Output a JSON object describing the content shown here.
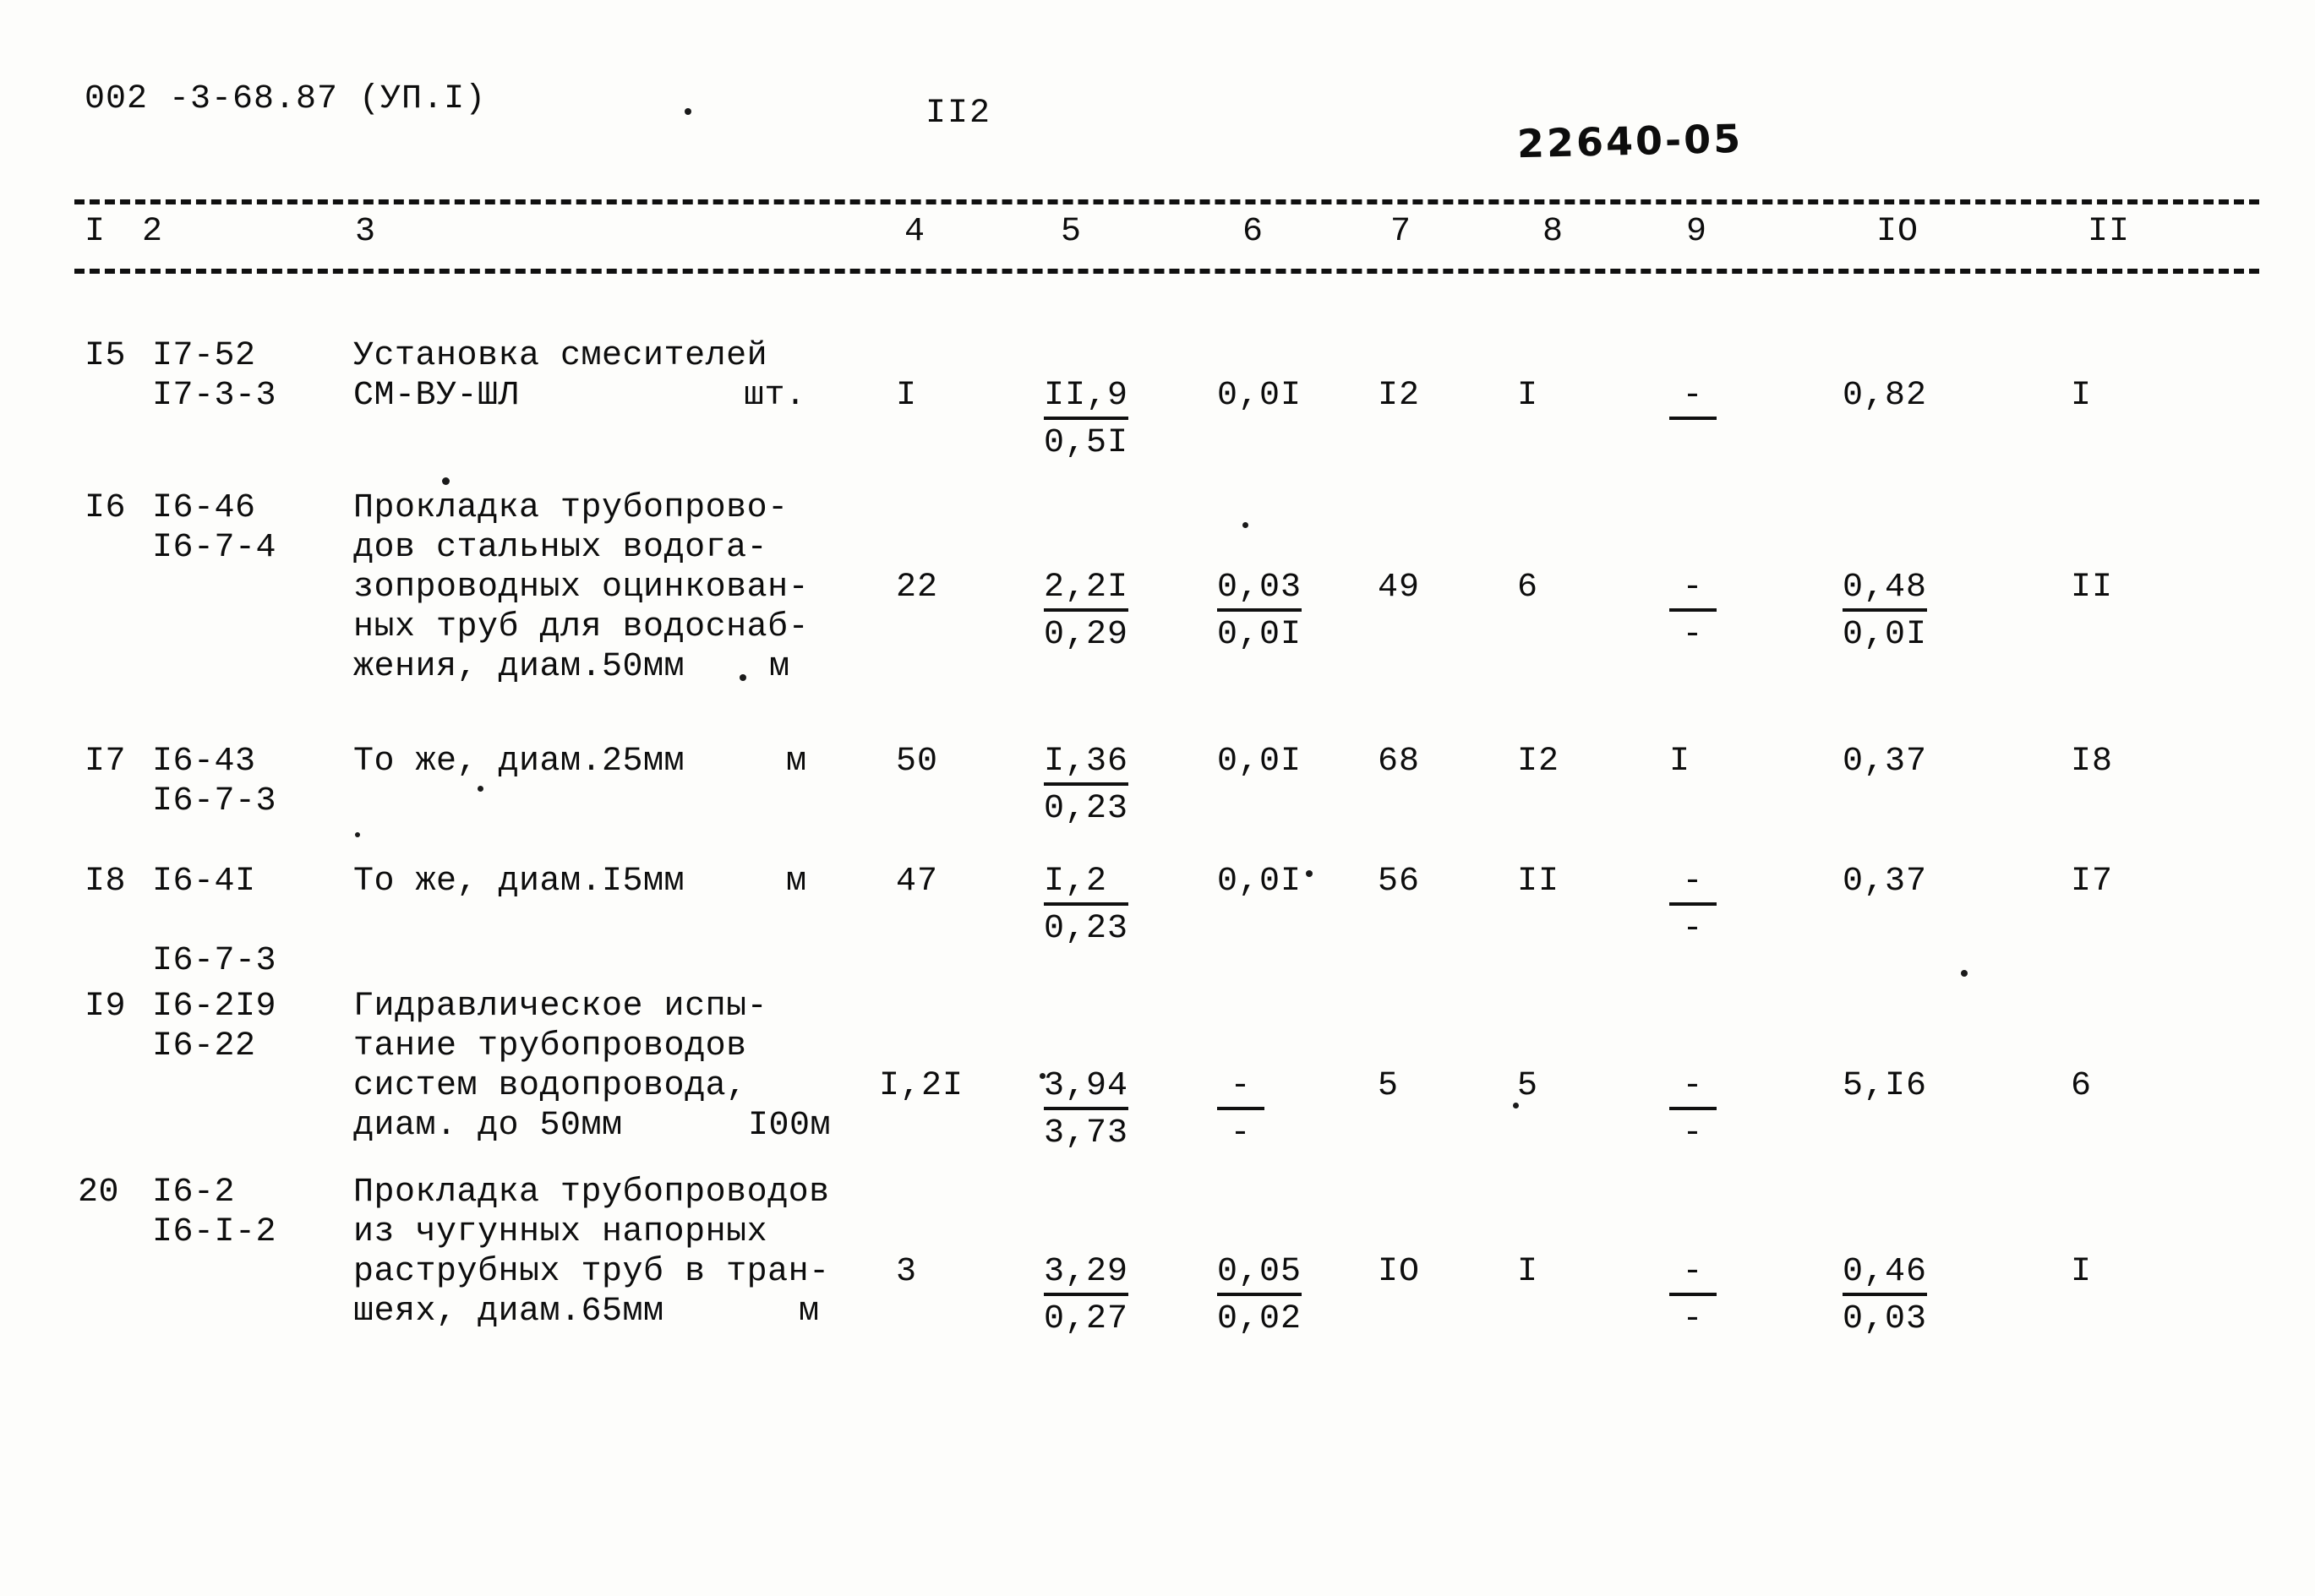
{
  "header": {
    "document_code": "002 -3-68.87  (УП.I)",
    "page_number": "II2",
    "archive_stamp": "22640-05"
  },
  "table": {
    "column_numbers": [
      "I",
      "2",
      "3",
      "4",
      "5",
      "6",
      "7",
      "8",
      "9",
      "IO",
      "II"
    ],
    "rows": [
      {
        "no": "I5",
        "code_top": "I7-52",
        "code_bottom": "I7-3-3",
        "desc_lines": [
          "Установка смесителей",
          "СМ-ВУ-ШЛ"
        ],
        "unit": "шт.",
        "c4": "I",
        "c5_top": "II,9",
        "c5_bottom": "0,5I",
        "c6_top": "0,0I",
        "c6_bottom": "",
        "c7": "I2",
        "c8": "I",
        "c9_top": "-",
        "c9_bottom": "",
        "c10_top": "0,82",
        "c10_bottom": "",
        "c11": "I"
      },
      {
        "no": "I6",
        "code_top": "I6-46",
        "code_bottom": "I6-7-4",
        "desc_lines": [
          "Прокладка трубопрово-",
          "дов стальных водога-",
          "зопроводных оцинкован-",
          "ных труб для водоснаб-",
          "жения, диам.50мм"
        ],
        "unit": "м",
        "c4": "22",
        "c5_top": "2,2I",
        "c5_bottom": "0,29",
        "c6_top": "0,03",
        "c6_bottom": "0,0I",
        "c7": "49",
        "c8": "6",
        "c9_top": "-",
        "c9_bottom": "-",
        "c10_top": "0,48",
        "c10_bottom": "0,0I",
        "c11": "II"
      },
      {
        "no": "I7",
        "code_top": "I6-43",
        "code_bottom": "I6-7-3",
        "desc_lines": [
          "То же, диам.25мм"
        ],
        "unit": "м",
        "c4": "50",
        "c5_top": "I,36",
        "c5_bottom": "0,23",
        "c6_top": "0,0I",
        "c6_bottom": "",
        "c7": "68",
        "c8": "I2",
        "c9_top": "I",
        "c9_bottom": "",
        "c10_top": "0,37",
        "c10_bottom": "",
        "c11": "I8"
      },
      {
        "no": "I8",
        "code_top": "I6-4I",
        "code_bottom": "I6-7-3",
        "desc_lines": [
          "То же, диам.I5мм"
        ],
        "unit": "м",
        "c4": "47",
        "c5_top": "I,2",
        "c5_bottom": "0,23",
        "c6_top": "0,0I",
        "c6_bottom": "",
        "c7": "56",
        "c8": "II",
        "c9_top": "-",
        "c9_bottom": "-",
        "c10_top": "0,37",
        "c10_bottom": "",
        "c11": "I7"
      },
      {
        "no": "I9",
        "code_top": "I6-2I9",
        "code_bottom": "I6-22",
        "desc_lines": [
          "Гидравлическое испы-",
          "тание трубопроводов",
          "систем водопровода,",
          "диам. до 50мм"
        ],
        "unit": "I00м",
        "c4": "I,2I",
        "c5_top": "3,94",
        "c5_bottom": "3,73",
        "c6_top": "-",
        "c6_bottom": "-",
        "c7": "5",
        "c8": "5",
        "c9_top": "-",
        "c9_bottom": "-",
        "c10_top": "5,I6",
        "c10_bottom": "",
        "c11": "6"
      },
      {
        "no": "20",
        "code_top": "I6-2",
        "code_bottom": "I6-I-2",
        "desc_lines": [
          "Прокладка трубопроводов",
          "из чугунных напорных",
          "раструбных труб в тран-",
          "шеях, диам.65мм"
        ],
        "unit": "м",
        "c4": "3",
        "c5_top": "3,29",
        "c5_bottom": "0,27",
        "c6_top": "0,05",
        "c6_bottom": "0,02",
        "c7": "IO",
        "c8": "I",
        "c9_top": "-",
        "c9_bottom": "-",
        "c10_top": "0,46",
        "c10_bottom": "0,03",
        "c11": "I"
      }
    ]
  }
}
